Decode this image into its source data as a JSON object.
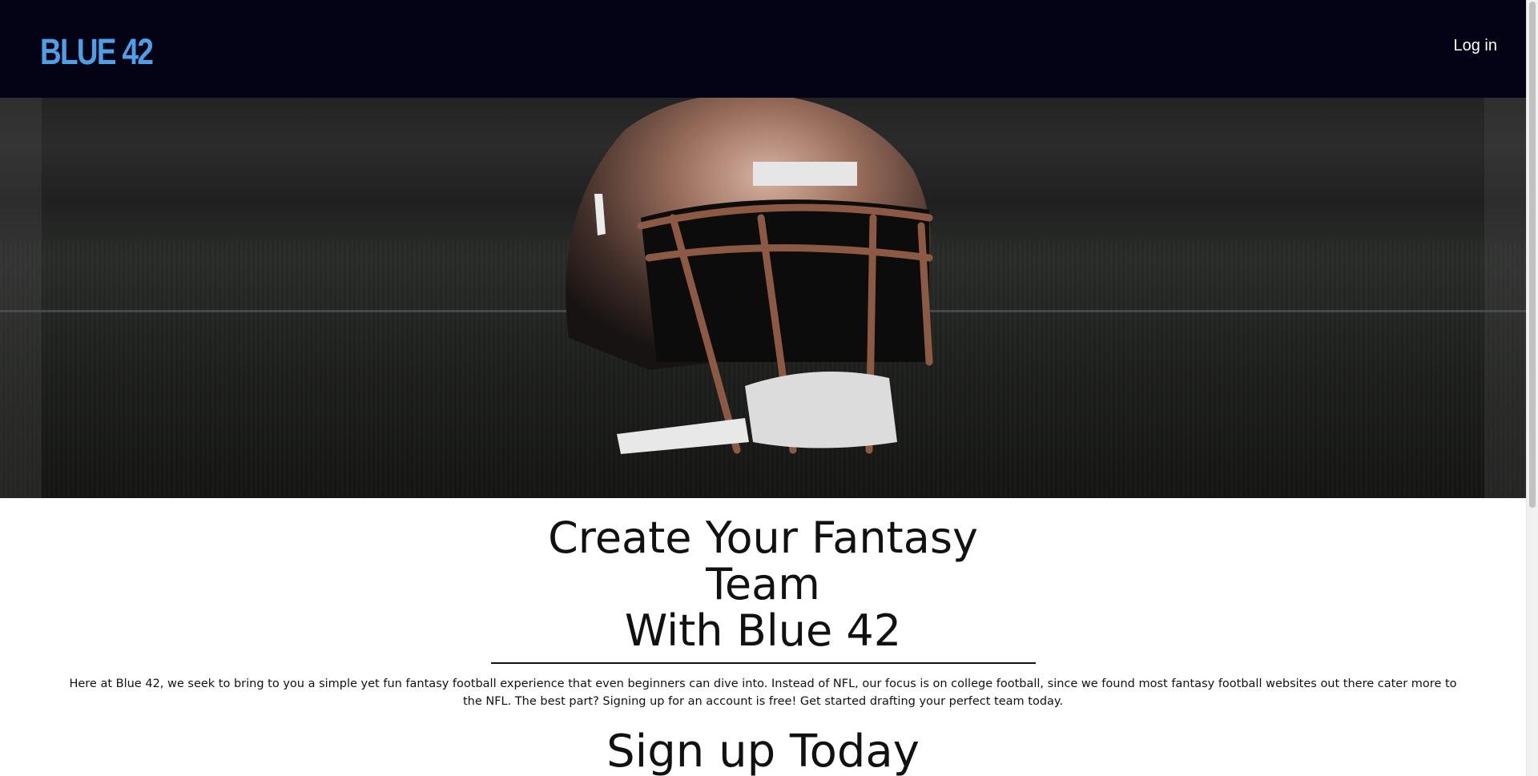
{
  "navbar": {
    "brand": "BLUE 42",
    "login_label": "Log in"
  },
  "hero": {
    "image_alt": "football helmet on grass field"
  },
  "main": {
    "headline_line1": "Create Your Fantasy Team",
    "headline_line2": "With Blue 42",
    "intro": "Here at Blue 42, we seek to bring to you a simple yet fun fantasy football experience that even beginners can dive into. Instead of NFL, our focus is on college football, since we found most fantasy football websites out there cater more to the NFL. The best part? Signing up for an account is free! Get started drafting your perfect team today.",
    "signup_heading": "Sign up Today"
  },
  "colors": {
    "navbar_bg": "#040316",
    "brand": "#4e9fe6",
    "text": "#111111"
  },
  "icons": {
    "hero_image": "helmet-icon"
  }
}
